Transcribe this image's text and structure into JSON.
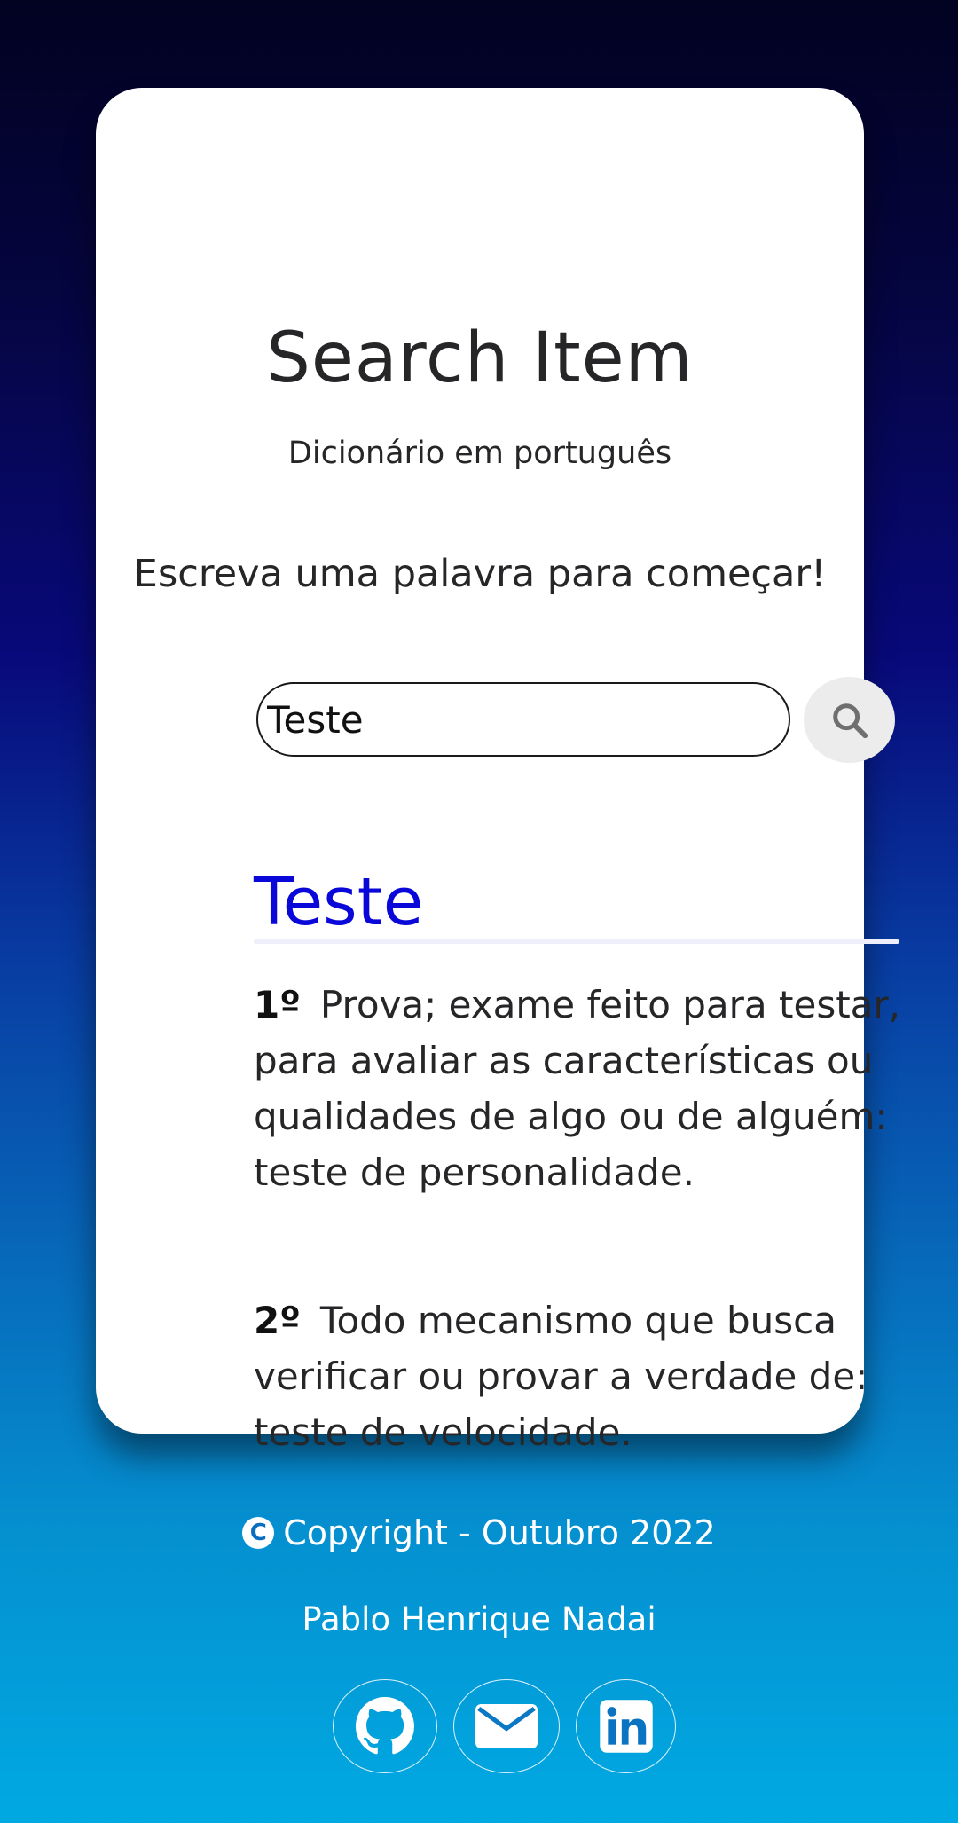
{
  "header": {
    "title": "Search Item",
    "subtitle": "Dicionário em português",
    "prompt": "Escreva uma palavra para começar!"
  },
  "search": {
    "value": "Teste",
    "button_icon": "search-icon"
  },
  "result": {
    "word": "Teste",
    "definitions": [
      {
        "number": "1º",
        "text": "Prova; exame feito para testar, para avaliar as características ou qualidades de algo ou de alguém: teste de personalidade."
      },
      {
        "number": "2º",
        "text": "Todo mecanismo que busca verificar ou provar a verdade de: teste de velocidade."
      }
    ]
  },
  "footer": {
    "copyright_symbol": "C",
    "copyright": "Copyright - Outubro 2022",
    "author": "Pablo Henrique Nadai",
    "links": [
      {
        "icon": "github-icon"
      },
      {
        "icon": "email-icon"
      },
      {
        "icon": "linkedin-icon"
      }
    ]
  },
  "colors": {
    "accent": "#0a08d8",
    "card": "#ffffff",
    "text": "#262628"
  }
}
